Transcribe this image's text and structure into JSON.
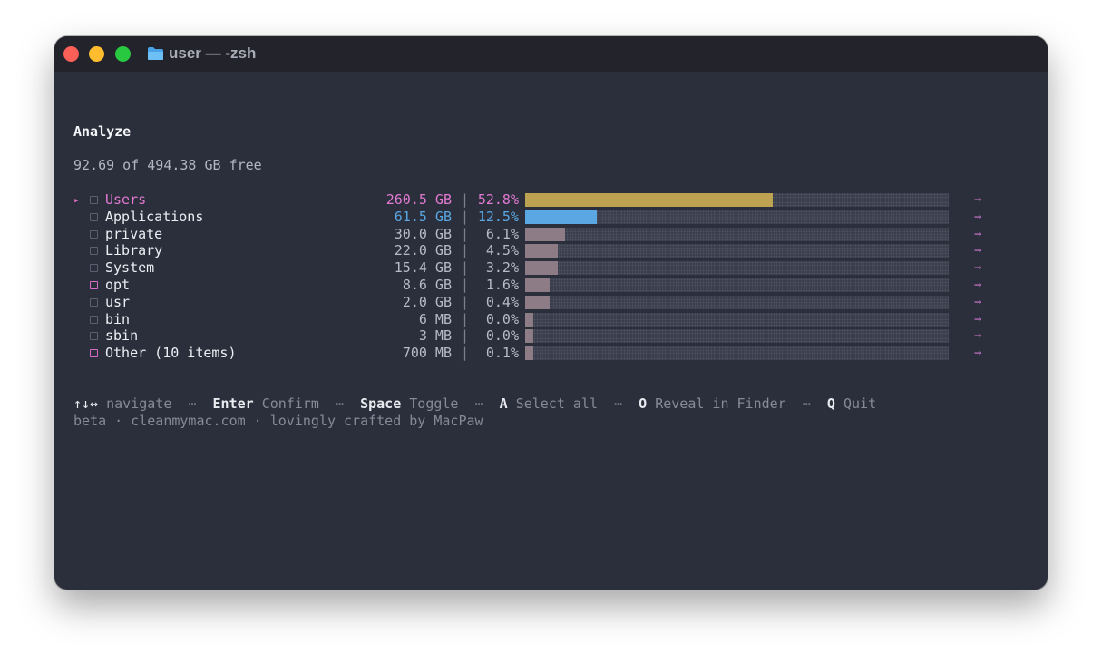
{
  "window": {
    "title": "user — -zsh",
    "folder_icon": "folder-icon",
    "traffic_lights": {
      "close": "#fe5f57",
      "minimize": "#febc2e",
      "zoom": "#28c840"
    }
  },
  "analyze": {
    "heading": "Analyze",
    "free_text": "92.69 of 494.38 GB free",
    "rows": [
      {
        "name": "Users",
        "size": "260.5 GB",
        "percent": "52.8%",
        "fill_fraction": 0.585,
        "fill_color": "#bda252",
        "selected": true
      },
      {
        "name": "Applications",
        "size": "61.5 GB",
        "percent": "12.5%",
        "fill_fraction": 0.17,
        "fill_color": "#5aa7e3"
      },
      {
        "name": "private",
        "size": "30.0 GB",
        "percent": "6.1%",
        "fill_fraction": 0.095,
        "fill_color": "#8d7c86"
      },
      {
        "name": "Library",
        "size": "22.0 GB",
        "percent": "4.5%",
        "fill_fraction": 0.077,
        "fill_color": "#8d7c86"
      },
      {
        "name": "System",
        "size": "15.4 GB",
        "percent": "3.2%",
        "fill_fraction": 0.077,
        "fill_color": "#8d7c86"
      },
      {
        "name": "opt",
        "size": "8.6 GB",
        "percent": "1.6%",
        "fill_fraction": 0.058,
        "fill_color": "#8d7c86"
      },
      {
        "name": "usr",
        "size": "2.0 GB",
        "percent": "0.4%",
        "fill_fraction": 0.058,
        "fill_color": "#8d7c86"
      },
      {
        "name": "bin",
        "size": "6 MB",
        "percent": "0.0%",
        "fill_fraction": 0.019,
        "fill_color": "#8d7c86"
      },
      {
        "name": "sbin",
        "size": "3 MB",
        "percent": "0.0%",
        "fill_fraction": 0.019,
        "fill_color": "#8d7c86"
      },
      {
        "name": "Other (10 items)",
        "size": "700 MB",
        "percent": "0.1%",
        "fill_fraction": 0.019,
        "fill_color": "#8d7c86"
      }
    ],
    "separator": "|",
    "arrow": "→",
    "caret": "▸"
  },
  "help": {
    "arrows": "↑↓↔",
    "navigate": "navigate",
    "dots": "⋯",
    "enter_key": "Enter",
    "enter_label": "Confirm",
    "space_key": "Space",
    "space_label": "Toggle",
    "a_key": "A",
    "a_label": "Select all",
    "o_key": "O",
    "o_label": "Reveal in Finder",
    "q_key": "Q",
    "q_label": "Quit",
    "credits": "beta · cleanmymac.com · lovingly crafted by MacPaw"
  }
}
